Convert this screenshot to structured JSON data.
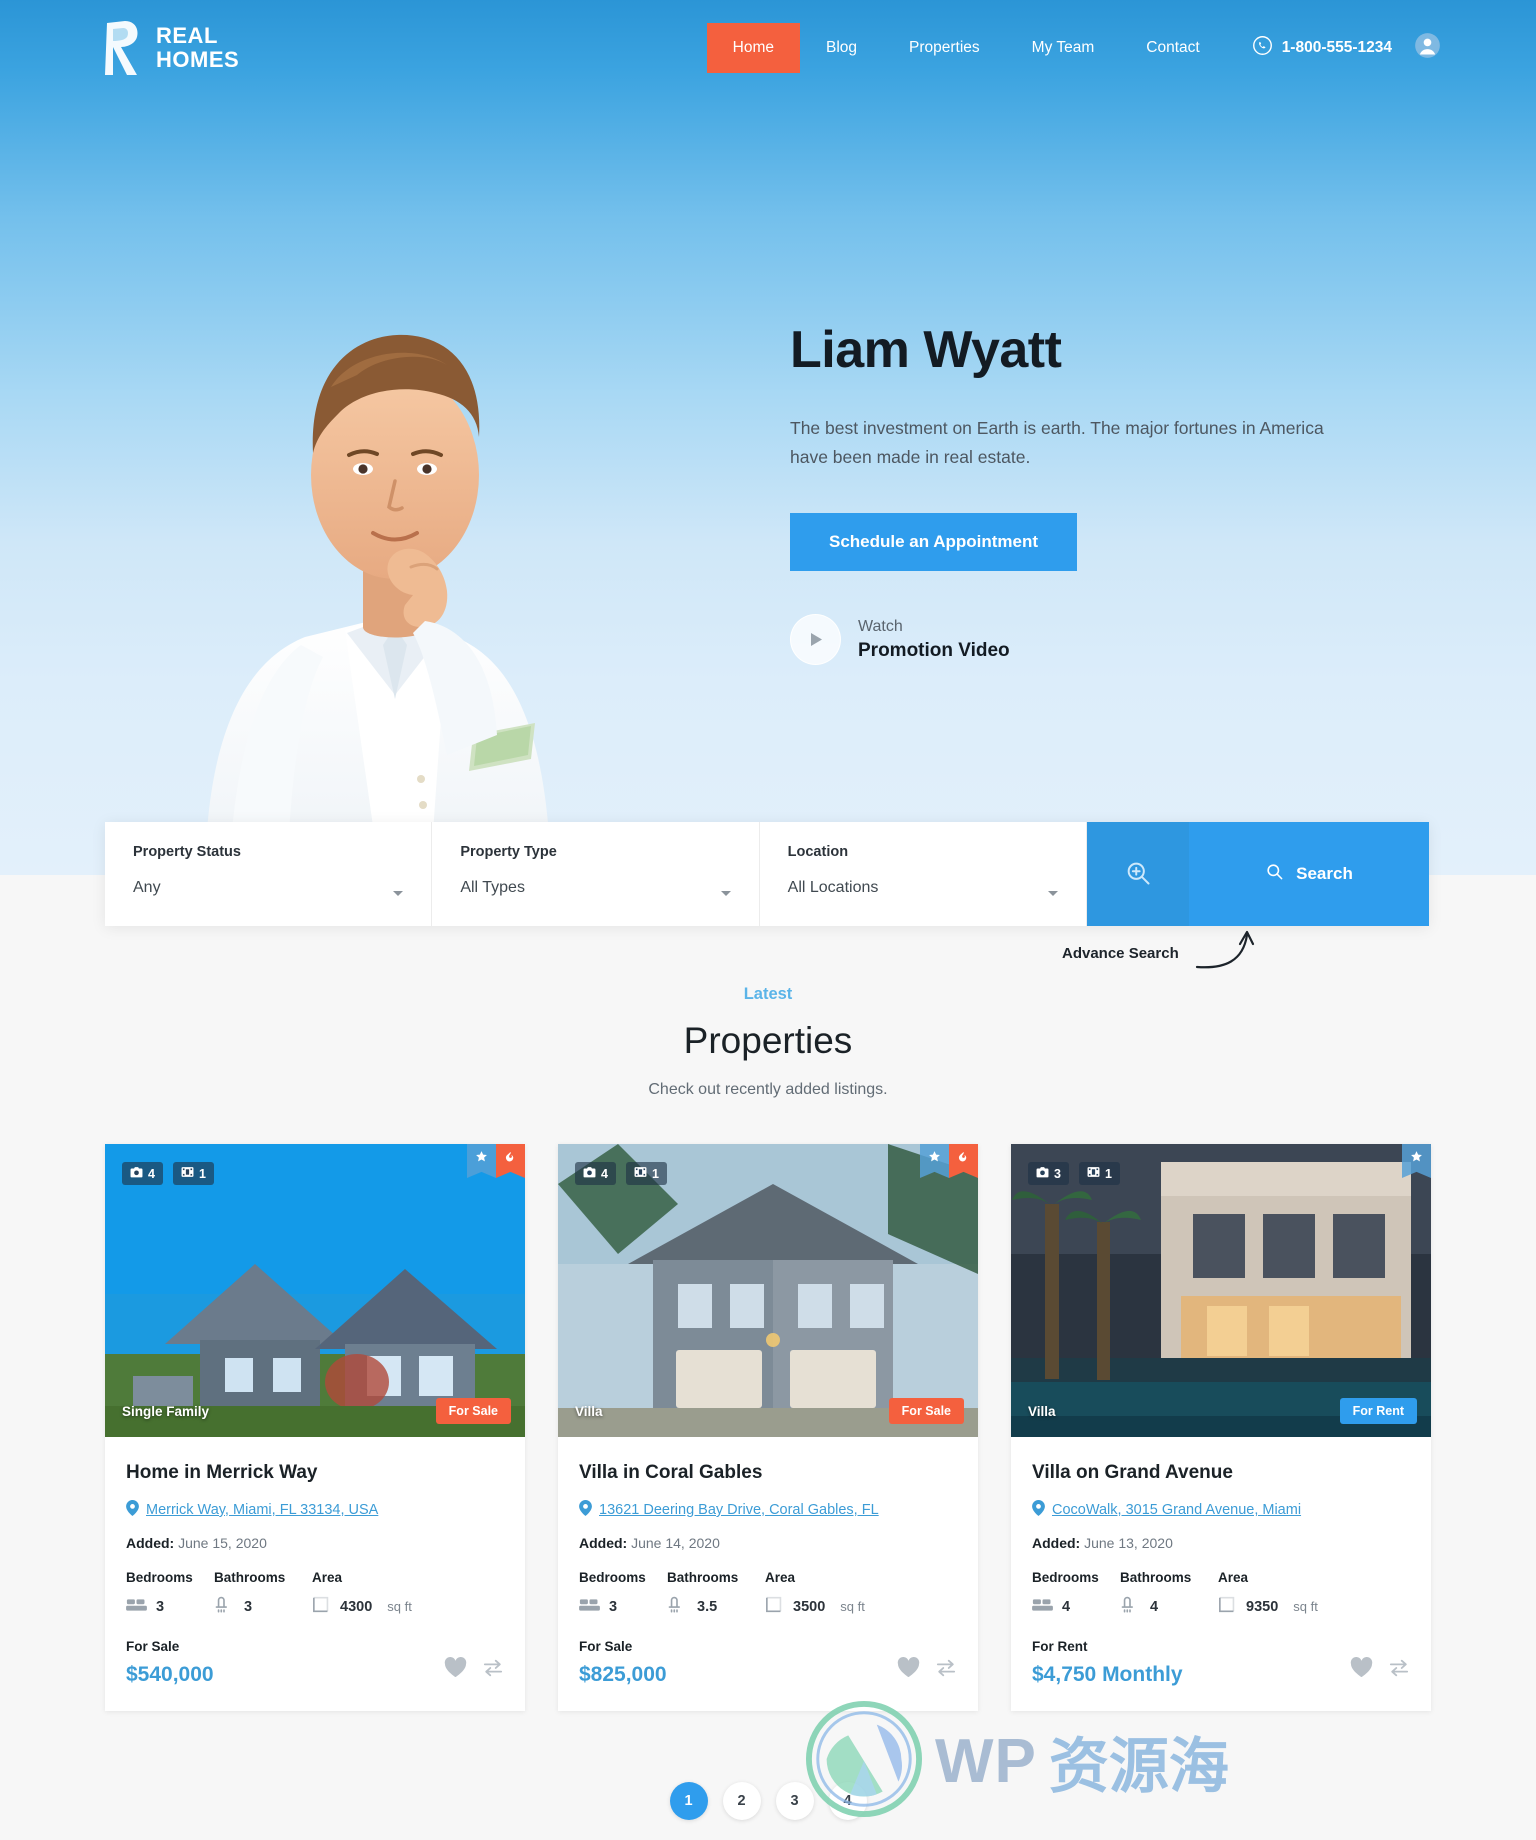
{
  "header": {
    "logo_line1": "REAL",
    "logo_line2": "HOMES",
    "nav": [
      {
        "label": "Home",
        "active": true
      },
      {
        "label": "Blog",
        "active": false
      },
      {
        "label": "Properties",
        "active": false
      },
      {
        "label": "My Team",
        "active": false
      },
      {
        "label": "Contact",
        "active": false
      }
    ],
    "phone": "1-800-555-1234",
    "accent_active": "#f4603e"
  },
  "hero": {
    "name": "Liam Wyatt",
    "description": "The best investment on Earth is earth. The major fortunes in America have been made in real estate.",
    "cta_label": "Schedule an Appointment",
    "video_eyebrow": "Watch",
    "video_title": "Promotion Video"
  },
  "search": {
    "fields": [
      {
        "label": "Property Status",
        "value": "Any"
      },
      {
        "label": "Property Type",
        "value": "All Types"
      },
      {
        "label": "Location",
        "value": "All Locations"
      }
    ],
    "search_label": "Search",
    "advance_note": "Advance Search"
  },
  "section": {
    "eyebrow": "Latest",
    "title": "Properties",
    "subtitle": "Check out recently added listings."
  },
  "properties": [
    {
      "title": "Home in Merrick Way",
      "address": "Merrick Way, Miami, FL 33134, USA",
      "added_label": "Added:",
      "added": "June 15, 2020",
      "type_tag": "Single Family",
      "status_tag": "For Sale",
      "status_kind": "sale",
      "photos": "4",
      "videos": "1",
      "has_star": true,
      "has_hot": true,
      "labels": {
        "bedrooms": "Bedrooms",
        "bathrooms": "Bathrooms",
        "area": "Area"
      },
      "bedrooms": "3",
      "bathrooms": "3",
      "area": "4300",
      "area_unit": "sq ft",
      "price_status": "For Sale",
      "price": "$540,000"
    },
    {
      "title": "Villa in Coral Gables",
      "address": "13621 Deering Bay Drive, Coral Gables, FL",
      "added_label": "Added:",
      "added": "June 14, 2020",
      "type_tag": "Villa",
      "status_tag": "For Sale",
      "status_kind": "sale",
      "photos": "4",
      "videos": "1",
      "has_star": true,
      "has_hot": true,
      "labels": {
        "bedrooms": "Bedrooms",
        "bathrooms": "Bathrooms",
        "area": "Area"
      },
      "bedrooms": "3",
      "bathrooms": "3.5",
      "area": "3500",
      "area_unit": "sq ft",
      "price_status": "For Sale",
      "price": "$825,000"
    },
    {
      "title": "Villa on Grand Avenue",
      "address": "CocoWalk, 3015 Grand Avenue, Miami",
      "added_label": "Added:",
      "added": "June 13, 2020",
      "type_tag": "Villa",
      "status_tag": "For Rent",
      "status_kind": "rent",
      "photos": "3",
      "videos": "1",
      "has_star": true,
      "has_hot": false,
      "labels": {
        "bedrooms": "Bedrooms",
        "bathrooms": "Bathrooms",
        "area": "Area"
      },
      "bedrooms": "4",
      "bathrooms": "4",
      "area": "9350",
      "area_unit": "sq ft",
      "price_status": "For Rent",
      "price": "$4,750 Monthly"
    }
  ],
  "pagination": [
    {
      "label": "1",
      "active": true
    },
    {
      "label": "2",
      "active": false
    },
    {
      "label": "3",
      "active": false
    },
    {
      "label": "4",
      "active": false
    }
  ],
  "watermark": {
    "latin": "WP",
    "cjk": "资源海"
  }
}
